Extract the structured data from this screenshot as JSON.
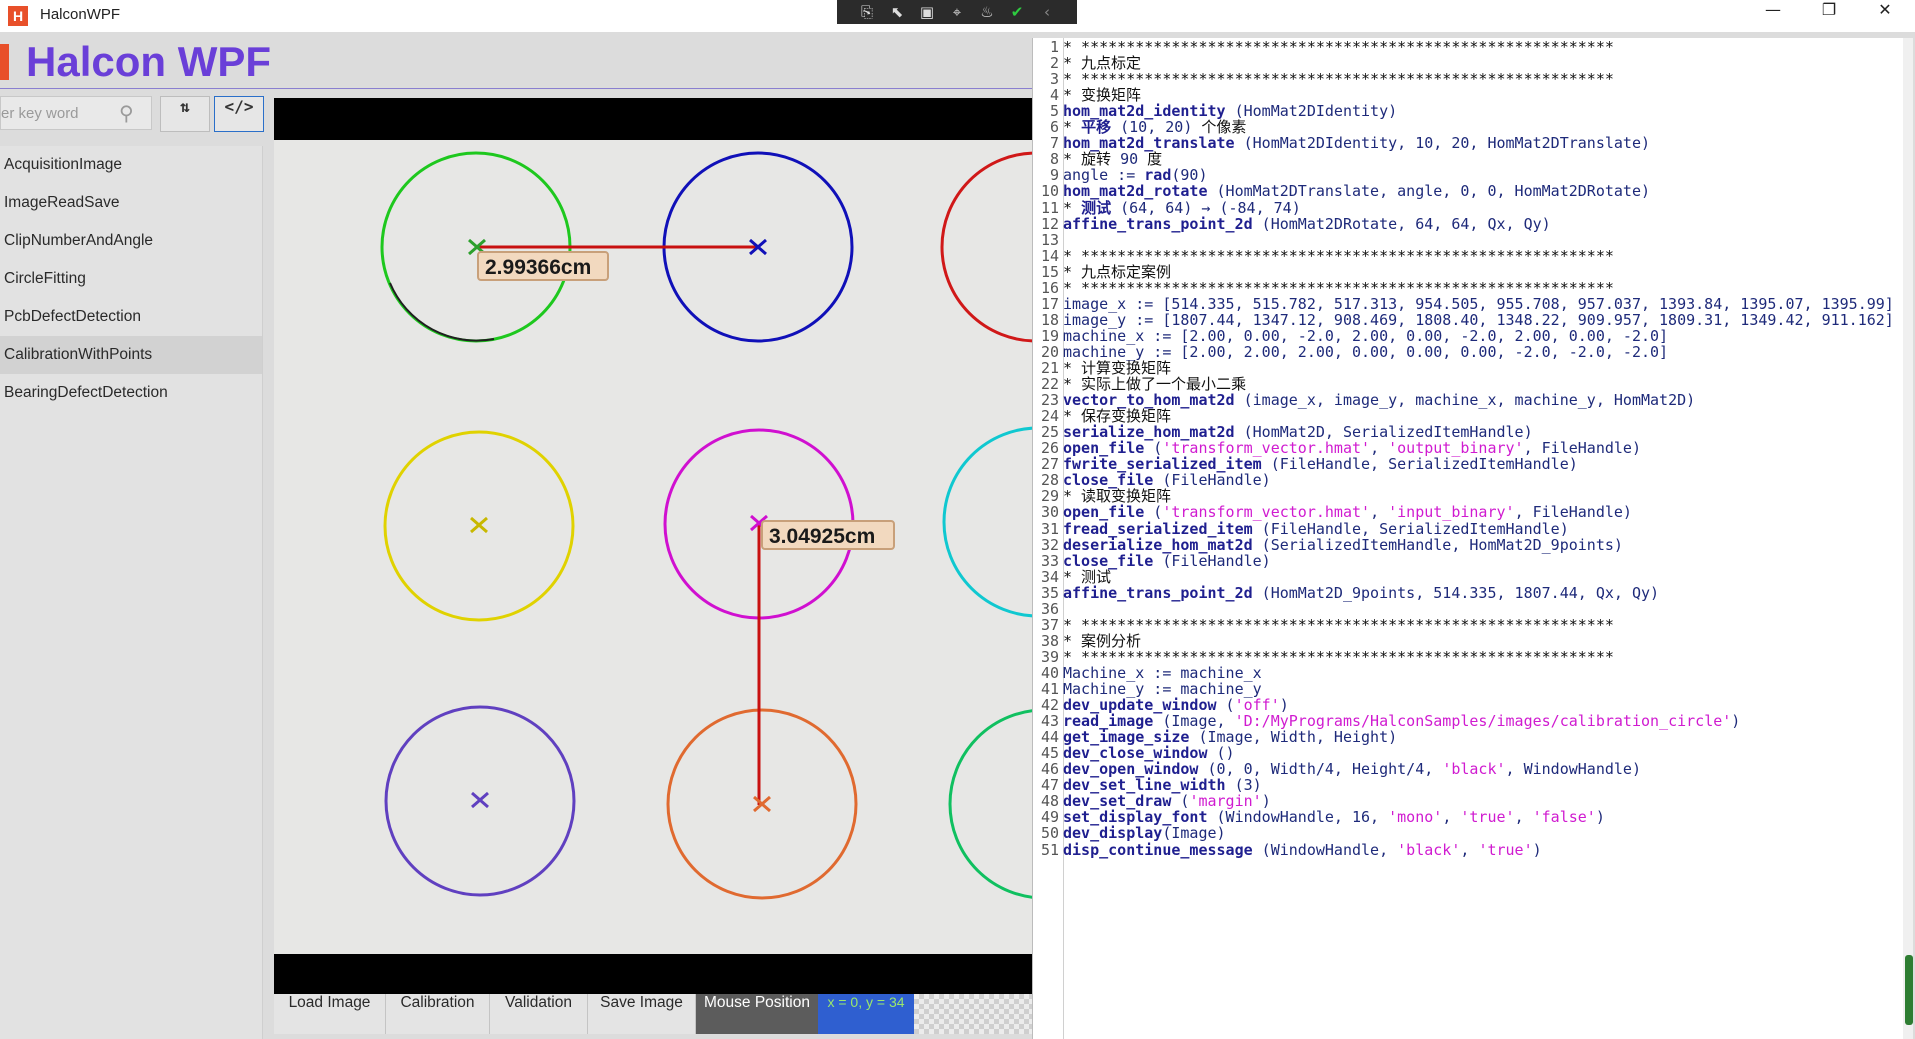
{
  "window": {
    "app_icon_letter": "H",
    "title": "HalconWPF",
    "controls": [
      "—",
      "❐",
      "✕"
    ]
  },
  "devtools": {
    "icons": [
      "live-visual-tree-icon",
      "select-element-icon",
      "display-layout-adorners-icon",
      "track-focus-icon",
      "hot-reload-icon",
      "binding-failures-ok-icon",
      "collapse-icon"
    ]
  },
  "header": {
    "title": "Halcon WPF"
  },
  "search": {
    "placeholder": "er key word"
  },
  "toolbar": {
    "sort_label": "⇅",
    "code_label": "</>"
  },
  "sidebar": {
    "items": [
      {
        "label": "AcquisitionImage",
        "selected": false
      },
      {
        "label": "ImageReadSave",
        "selected": false
      },
      {
        "label": "ClipNumberAndAngle",
        "selected": false
      },
      {
        "label": "CircleFitting",
        "selected": false
      },
      {
        "label": "PcbDefectDetection",
        "selected": false
      },
      {
        "label": "CalibrationWithPoints",
        "selected": true
      },
      {
        "label": "BearingDefectDetection",
        "selected": false
      }
    ]
  },
  "image": {
    "measure_h_label": "2.99366cm",
    "measure_v_label": "3.04925cm",
    "circles": [
      {
        "color": "#1ec81e",
        "marker": "#2ca02c"
      },
      {
        "color": "#1010b8",
        "marker": "#1010b8"
      },
      {
        "color": "#d01818",
        "marker": "#d01818"
      },
      {
        "color": "#e0d200",
        "marker": "#c8b800"
      },
      {
        "color": "#d010d0",
        "marker": "#d010d0"
      },
      {
        "color": "#10c8d0",
        "marker": "#10c8d0"
      },
      {
        "color": "#6040c0",
        "marker": "#6040c0"
      },
      {
        "color": "#e06a30",
        "marker": "#e06a30"
      },
      {
        "color": "#10c060",
        "marker": "#10c060"
      }
    ],
    "measure_color": "#c81010"
  },
  "bottom": {
    "buttons": [
      "Load Image",
      "Calibration",
      "Validation",
      "Save Image"
    ],
    "mouse_label": "Mouse Position",
    "mouse_value": "x = 0, y = 34"
  },
  "code": {
    "lines": [
      [
        [
          "c",
          "* ***********************************************************"
        ]
      ],
      [
        [
          "c",
          "* 九点标定"
        ]
      ],
      [
        [
          "c",
          "* ***********************************************************"
        ]
      ],
      [
        [
          "c",
          "* 变换矩阵"
        ]
      ],
      [
        [
          "k",
          "hom_mat2d_identity"
        ],
        [
          "p",
          " (HomMat2DIdentity)"
        ]
      ],
      [
        [
          "c",
          "* "
        ],
        [
          "cb",
          "平移"
        ],
        [
          "p",
          " (10, 20) "
        ],
        [
          "c",
          "个像素"
        ]
      ],
      [
        [
          "k",
          "hom_mat2d_translate"
        ],
        [
          "p",
          " (HomMat2DIdentity, 10, 20, HomMat2DTranslate)"
        ]
      ],
      [
        [
          "c",
          "* 旋转 "
        ],
        [
          "p",
          "90"
        ],
        [
          "c",
          " 度"
        ]
      ],
      [
        [
          "p",
          "angle := "
        ],
        [
          "k",
          "rad"
        ],
        [
          "p",
          "(90)"
        ]
      ],
      [
        [
          "k",
          "hom_mat2d_rotate"
        ],
        [
          "p",
          " (HomMat2DTranslate, angle, 0, 0, HomMat2DRotate)"
        ]
      ],
      [
        [
          "c",
          "* "
        ],
        [
          "cb",
          "测试"
        ],
        [
          "p",
          " (64, 64) → (-84, 74)"
        ]
      ],
      [
        [
          "k",
          "affine_trans_point_2d"
        ],
        [
          "p",
          " (HomMat2DRotate, 64, 64, Qx, Qy)"
        ]
      ],
      [
        [
          "p",
          ""
        ]
      ],
      [
        [
          "c",
          "* ***********************************************************"
        ]
      ],
      [
        [
          "c",
          "* 九点标定案例"
        ]
      ],
      [
        [
          "c",
          "* ***********************************************************"
        ]
      ],
      [
        [
          "p",
          "image_x := [514.335, 515.782, 517.313, 954.505, 955.708, 957.037, 1393.84, 1395.07, 1395.99]"
        ]
      ],
      [
        [
          "p",
          "image_y := [1807.44, 1347.12, 908.469, 1808.40, 1348.22, 909.957, 1809.31, 1349.42, 911.162]"
        ]
      ],
      [
        [
          "p",
          "machine_x := [2.00, 0.00, -2.0, 2.00, 0.00, -2.0, 2.00, 0.00, -2.0]"
        ]
      ],
      [
        [
          "p",
          "machine_y := [2.00, 2.00, 2.00, 0.00, 0.00, 0.00, -2.0, -2.0, -2.0]"
        ]
      ],
      [
        [
          "c",
          "* 计算变换矩阵"
        ]
      ],
      [
        [
          "c",
          "* 实际上做了一个最小二乘"
        ]
      ],
      [
        [
          "k",
          "vector_to_hom_mat2d"
        ],
        [
          "p",
          " (image_x, image_y, machine_x, machine_y, HomMat2D)"
        ]
      ],
      [
        [
          "c",
          "* 保存变换矩阵"
        ]
      ],
      [
        [
          "k",
          "serialize_hom_mat2d"
        ],
        [
          "p",
          " (HomMat2D, SerializedItemHandle)"
        ]
      ],
      [
        [
          "k",
          "open_file"
        ],
        [
          "p",
          " ("
        ],
        [
          "s",
          "'transform_vector.hmat'"
        ],
        [
          "p",
          ", "
        ],
        [
          "s",
          "'output_binary'"
        ],
        [
          "p",
          ", FileHandle)"
        ]
      ],
      [
        [
          "k",
          "fwrite_serialized_item"
        ],
        [
          "p",
          " (FileHandle, SerializedItemHandle)"
        ]
      ],
      [
        [
          "k",
          "close_file"
        ],
        [
          "p",
          " (FileHandle)"
        ]
      ],
      [
        [
          "c",
          "* 读取变换矩阵"
        ]
      ],
      [
        [
          "k",
          "open_file"
        ],
        [
          "p",
          " ("
        ],
        [
          "s",
          "'transform_vector.hmat'"
        ],
        [
          "p",
          ", "
        ],
        [
          "s",
          "'input_binary'"
        ],
        [
          "p",
          ", FileHandle)"
        ]
      ],
      [
        [
          "k",
          "fread_serialized_item"
        ],
        [
          "p",
          " (FileHandle, SerializedItemHandle)"
        ]
      ],
      [
        [
          "k",
          "deserialize_hom_mat2d"
        ],
        [
          "p",
          " (SerializedItemHandle, HomMat2D_9points)"
        ]
      ],
      [
        [
          "k",
          "close_file"
        ],
        [
          "p",
          " (FileHandle)"
        ]
      ],
      [
        [
          "c",
          "* 测试"
        ]
      ],
      [
        [
          "k",
          "affine_trans_point_2d"
        ],
        [
          "p",
          " (HomMat2D_9points, 514.335, 1807.44, Qx, Qy)"
        ]
      ],
      [
        [
          "p",
          ""
        ]
      ],
      [
        [
          "c",
          "* ***********************************************************"
        ]
      ],
      [
        [
          "c",
          "* 案例分析"
        ]
      ],
      [
        [
          "c",
          "* ***********************************************************"
        ]
      ],
      [
        [
          "p",
          "Machine_x := machine_x"
        ]
      ],
      [
        [
          "p",
          "Machine_y := machine_y"
        ]
      ],
      [
        [
          "k",
          "dev_update_window"
        ],
        [
          "p",
          " ("
        ],
        [
          "s",
          "'off'"
        ],
        [
          "p",
          ")"
        ]
      ],
      [
        [
          "k",
          "read_image"
        ],
        [
          "p",
          " (Image, "
        ],
        [
          "s",
          "'D:/MyPrograms/HalconSamples/images/calibration_circle'"
        ],
        [
          "p",
          ")"
        ]
      ],
      [
        [
          "k",
          "get_image_size"
        ],
        [
          "p",
          " (Image, Width, Height)"
        ]
      ],
      [
        [
          "k",
          "dev_close_window"
        ],
        [
          "p",
          " ()"
        ]
      ],
      [
        [
          "k",
          "dev_open_window"
        ],
        [
          "p",
          " (0, 0, Width/4, Height/4, "
        ],
        [
          "s",
          "'black'"
        ],
        [
          "p",
          ", WindowHandle)"
        ]
      ],
      [
        [
          "k",
          "dev_set_line_width"
        ],
        [
          "p",
          " (3)"
        ]
      ],
      [
        [
          "k",
          "dev_set_draw"
        ],
        [
          "p",
          " ("
        ],
        [
          "s",
          "'margin'"
        ],
        [
          "p",
          ")"
        ]
      ],
      [
        [
          "k",
          "set_display_font"
        ],
        [
          "p",
          " (WindowHandle, 16, "
        ],
        [
          "s",
          "'mono'"
        ],
        [
          "p",
          ", "
        ],
        [
          "s",
          "'true'"
        ],
        [
          "p",
          ", "
        ],
        [
          "s",
          "'false'"
        ],
        [
          "p",
          ")"
        ]
      ],
      [
        [
          "k",
          "dev_display"
        ],
        [
          "p",
          "(Image)"
        ]
      ],
      [
        [
          "k",
          "disp_continue_message"
        ],
        [
          "p",
          " (WindowHandle, "
        ],
        [
          "s",
          "'black'"
        ],
        [
          "p",
          ", "
        ],
        [
          "s",
          "'true'"
        ],
        [
          "p",
          ")"
        ]
      ]
    ]
  }
}
